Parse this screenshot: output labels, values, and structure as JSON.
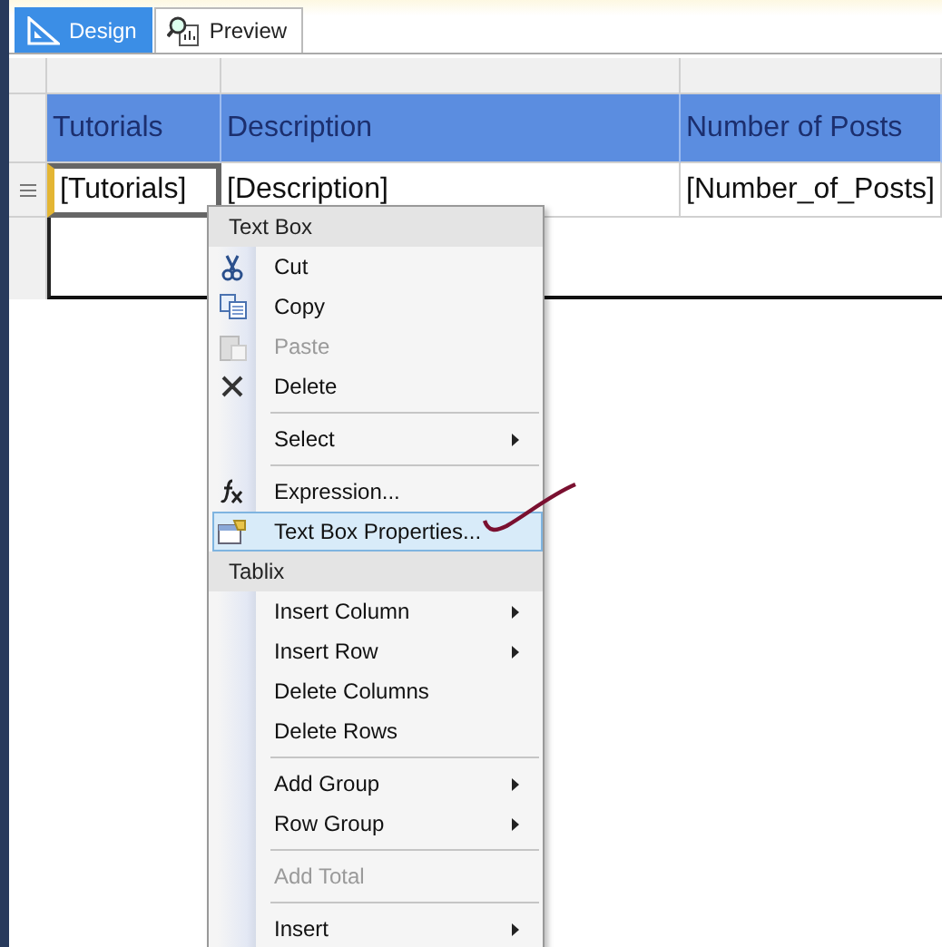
{
  "tabs": [
    {
      "label": "Design",
      "selected": true
    },
    {
      "label": "Preview",
      "selected": false
    }
  ],
  "table": {
    "header": [
      "Tutorials",
      "Description",
      "Number of Posts"
    ],
    "row": [
      {
        "text": "[Tutorials]",
        "selected": true
      },
      {
        "text": "[Description]",
        "selected": false
      },
      {
        "text": "[Number_of_Posts]",
        "selected": false
      }
    ]
  },
  "context_menu": {
    "sections": [
      {
        "header": "Text Box",
        "items": [
          {
            "kind": "item",
            "label": "Cut",
            "disabled": false,
            "submenu": false,
            "selected": false
          },
          {
            "kind": "item",
            "label": "Copy",
            "disabled": false,
            "submenu": false,
            "selected": false
          },
          {
            "kind": "item",
            "label": "Paste",
            "disabled": true,
            "submenu": false,
            "selected": false
          },
          {
            "kind": "item",
            "label": "Delete",
            "disabled": false,
            "submenu": false,
            "selected": false
          },
          {
            "kind": "separator"
          },
          {
            "kind": "item",
            "label": "Select",
            "disabled": false,
            "submenu": true,
            "selected": false
          },
          {
            "kind": "separator"
          },
          {
            "kind": "item",
            "label": "Expression...",
            "disabled": false,
            "submenu": false,
            "selected": false
          },
          {
            "kind": "item",
            "label": "Text Box Properties...",
            "disabled": false,
            "submenu": false,
            "selected": true
          }
        ]
      },
      {
        "header": "Tablix",
        "items": [
          {
            "kind": "item",
            "label": "Insert Column",
            "disabled": false,
            "submenu": true,
            "selected": false
          },
          {
            "kind": "item",
            "label": "Insert Row",
            "disabled": false,
            "submenu": true,
            "selected": false
          },
          {
            "kind": "item",
            "label": "Delete Columns",
            "disabled": false,
            "submenu": false,
            "selected": false
          },
          {
            "kind": "item",
            "label": "Delete Rows",
            "disabled": false,
            "submenu": false,
            "selected": false
          },
          {
            "kind": "separator"
          },
          {
            "kind": "item",
            "label": "Add Group",
            "disabled": false,
            "submenu": true,
            "selected": false
          },
          {
            "kind": "item",
            "label": "Row Group",
            "disabled": false,
            "submenu": true,
            "selected": false
          },
          {
            "kind": "separator"
          },
          {
            "kind": "item",
            "label": "Add Total",
            "disabled": true,
            "submenu": false,
            "selected": false
          },
          {
            "kind": "separator"
          },
          {
            "kind": "item",
            "label": "Insert",
            "disabled": false,
            "submenu": true,
            "selected": false
          }
        ]
      }
    ]
  }
}
